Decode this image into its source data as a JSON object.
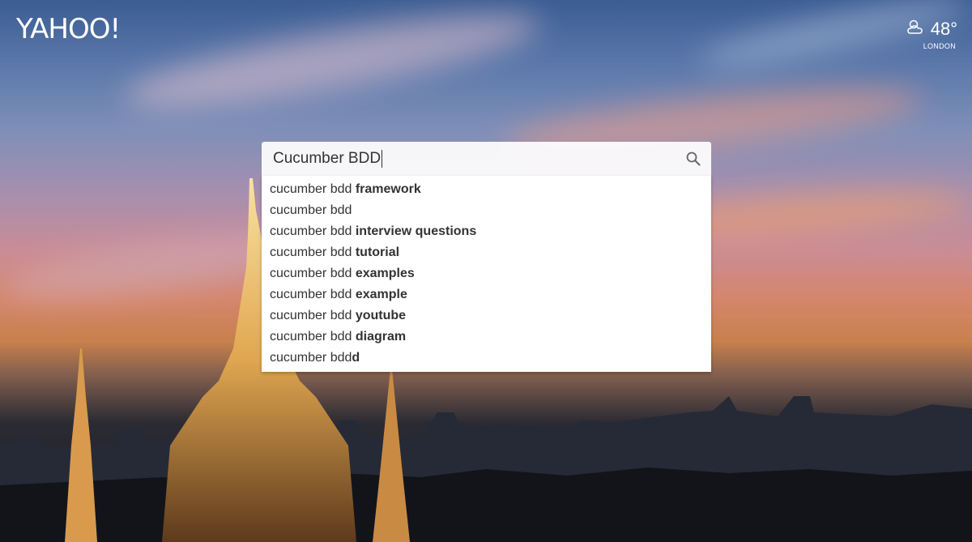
{
  "header": {
    "logo": "YAHOO!"
  },
  "weather": {
    "icon": "partly-cloudy-icon",
    "temperature": "48°",
    "location": "LONDON"
  },
  "search": {
    "value": "Cucumber BDD",
    "suggestions": [
      {
        "prefix": "cucumber bdd ",
        "bold": "framework"
      },
      {
        "prefix": "cucumber bdd",
        "bold": ""
      },
      {
        "prefix": "cucumber bdd ",
        "bold": "interview questions"
      },
      {
        "prefix": "cucumber bdd ",
        "bold": "tutorial"
      },
      {
        "prefix": "cucumber bdd ",
        "bold": "examples"
      },
      {
        "prefix": "cucumber bdd ",
        "bold": "example"
      },
      {
        "prefix": "cucumber bdd ",
        "bold": "youtube"
      },
      {
        "prefix": "cucumber bdd ",
        "bold": "diagram"
      },
      {
        "prefix": "cucumber bdd",
        "bold": "d"
      }
    ]
  }
}
